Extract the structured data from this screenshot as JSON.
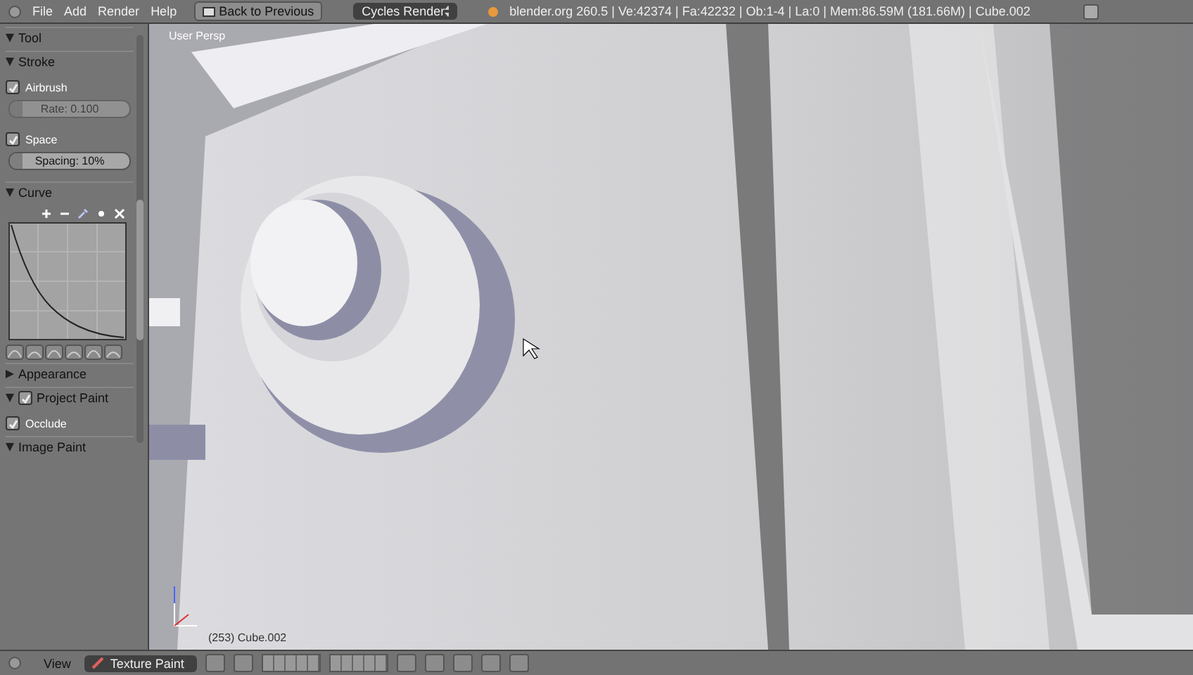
{
  "top_bar": {
    "menu": [
      "File",
      "Add",
      "Render",
      "Help"
    ],
    "back_button": "Back to Previous",
    "render_engine": "Cycles Render",
    "stats": "blender.org 260.5 | Ve:42374 | Fa:42232 | Ob:1-4 | La:0 | Mem:86.59M (181.66M) | Cube.002"
  },
  "tool_panel": [
    {
      "kind": "header",
      "label": "Tool",
      "expanded": true
    },
    {
      "kind": "header",
      "label": "Stroke",
      "expanded": true
    },
    {
      "kind": "checkbox",
      "label": "Airbrush",
      "checked": true
    },
    {
      "kind": "slider",
      "label": "Rate: 0.100",
      "level": 0.1,
      "disabled": true
    },
    {
      "kind": "checkbox",
      "label": "Space",
      "checked": true
    },
    {
      "kind": "slider",
      "label": "Spacing: 10%",
      "level": 0.1,
      "disabled": false
    },
    {
      "kind": "header",
      "label": "Curve",
      "expanded": true
    },
    {
      "kind": "curve"
    },
    {
      "kind": "header",
      "label": "Appearance",
      "expanded": false
    },
    {
      "kind": "header",
      "label": "Project Paint",
      "expanded": true,
      "checked": true
    },
    {
      "kind": "checkbox",
      "label": "Occlude",
      "checked": true
    },
    {
      "kind": "header",
      "label": "Image Paint",
      "expanded": true
    }
  ],
  "viewport": {
    "view_label": "User Persp",
    "object_label": "(253) Cube.002"
  },
  "bottom_bar": {
    "menu": [
      "View"
    ],
    "mode": "Texture Paint"
  }
}
